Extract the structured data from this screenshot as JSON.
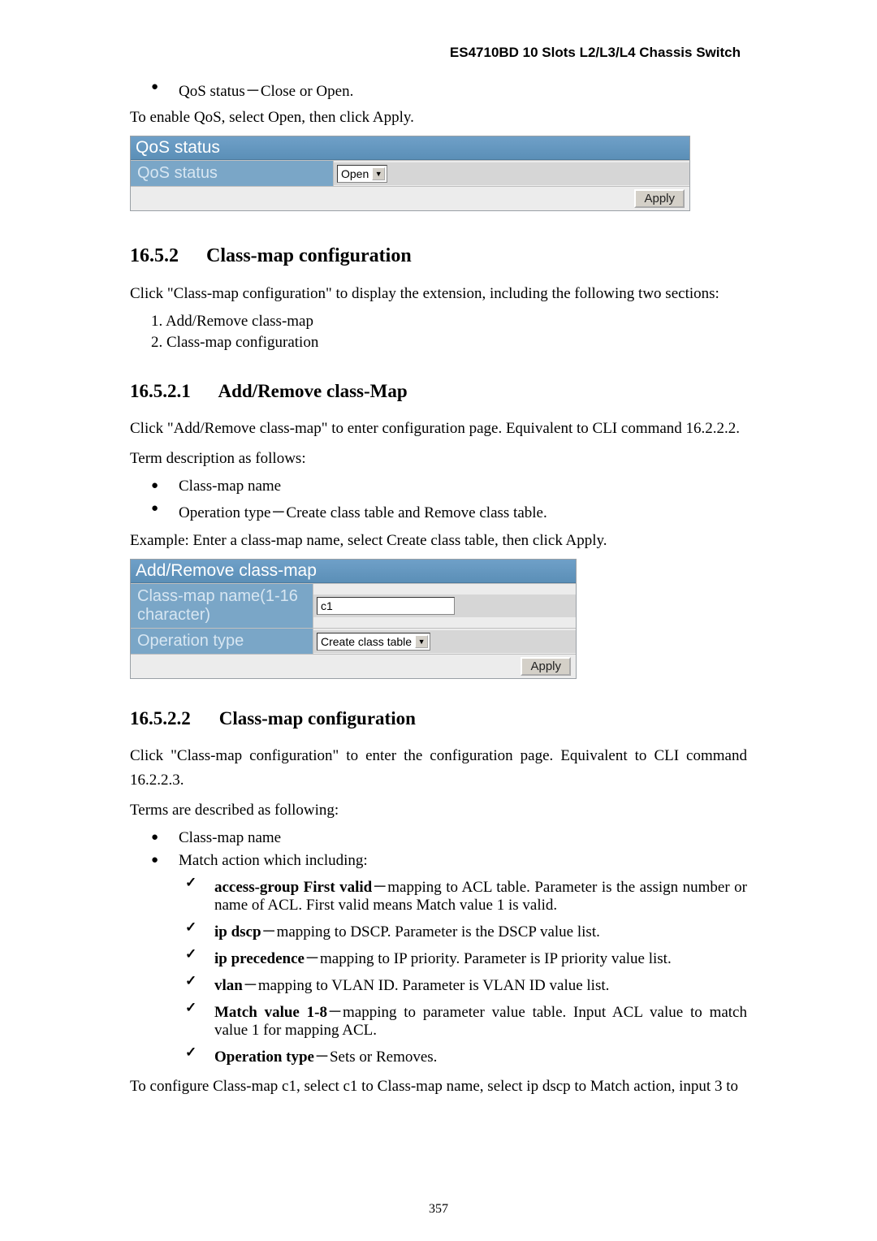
{
  "breadcrumb": "ES4710BD 10 Slots L2/L3/L4 Chassis Switch",
  "intro_bullet": "QoS status－Close or Open.",
  "intro_para": "To enable QoS, select Open, then click Apply.",
  "panel1": {
    "title": "QoS status",
    "label": "QoS status",
    "select_value": "Open",
    "apply": "Apply"
  },
  "h_1652_num": "16.5.2",
  "h_1652_text": "Class-map configuration",
  "p_1652_1": "Click \"Class-map configuration\" to display the extension, including the following two sections:",
  "ol_1652_1": "1.     Add/Remove class-map",
  "ol_1652_2": "2.     Class-map configuration",
  "h_16521_num": "16.5.2.1",
  "h_16521_text": "Add/Remove class-Map",
  "p_16521_1": "Click \"Add/Remove class-map\" to enter configuration page. Equivalent to CLI command 16.2.2.2.",
  "p_16521_2": "Term description as follows:",
  "b_16521_1": "Class-map name",
  "b_16521_2": "Operation type－Create class table and Remove class table.",
  "p_16521_3": "Example: Enter a class-map name, select Create class table, then click Apply.",
  "panel2": {
    "title": "Add/Remove class-map",
    "label1": "Class-map name(1-16 character)",
    "input_value": "c1",
    "label2": "Operation type",
    "select_value": "Create class table",
    "apply": "Apply"
  },
  "h_16522_num": "16.5.2.2",
  "h_16522_text": "Class-map configuration",
  "p_16522_1": "Click \"Class-map configuration\" to enter the configuration page. Equivalent to CLI command 16.2.2.3.",
  "p_16522_2": "Terms are described as following:",
  "b_16522_1": "Class-map name",
  "b_16522_2": "Match action which including:",
  "chk1_b": "access-group First valid",
  "chk1_t": "－mapping to ACL table. Parameter is the assign number or name of ACL. First valid means Match value 1 is valid.",
  "chk2_b": "ip dscp",
  "chk2_t": "－mapping to DSCP. Parameter is the DSCP value list.",
  "chk3_b": "ip precedence",
  "chk3_t": "－mapping to IP priority. Parameter is IP priority value list.",
  "chk4_b": "vlan",
  "chk4_t": "－mapping to VLAN ID. Parameter is VLAN ID value list.",
  "chk5_b": "Match value 1-8",
  "chk5_t": "－mapping to parameter value table. Input ACL value to match value 1 for mapping ACL.",
  "chk6_b": "Operation type",
  "chk6_t": "－Sets or Removes.",
  "p_last": "To configure Class-map c1, select c1 to Class-map name, select ip dscp to Match action, input 3 to",
  "page_number": "357"
}
